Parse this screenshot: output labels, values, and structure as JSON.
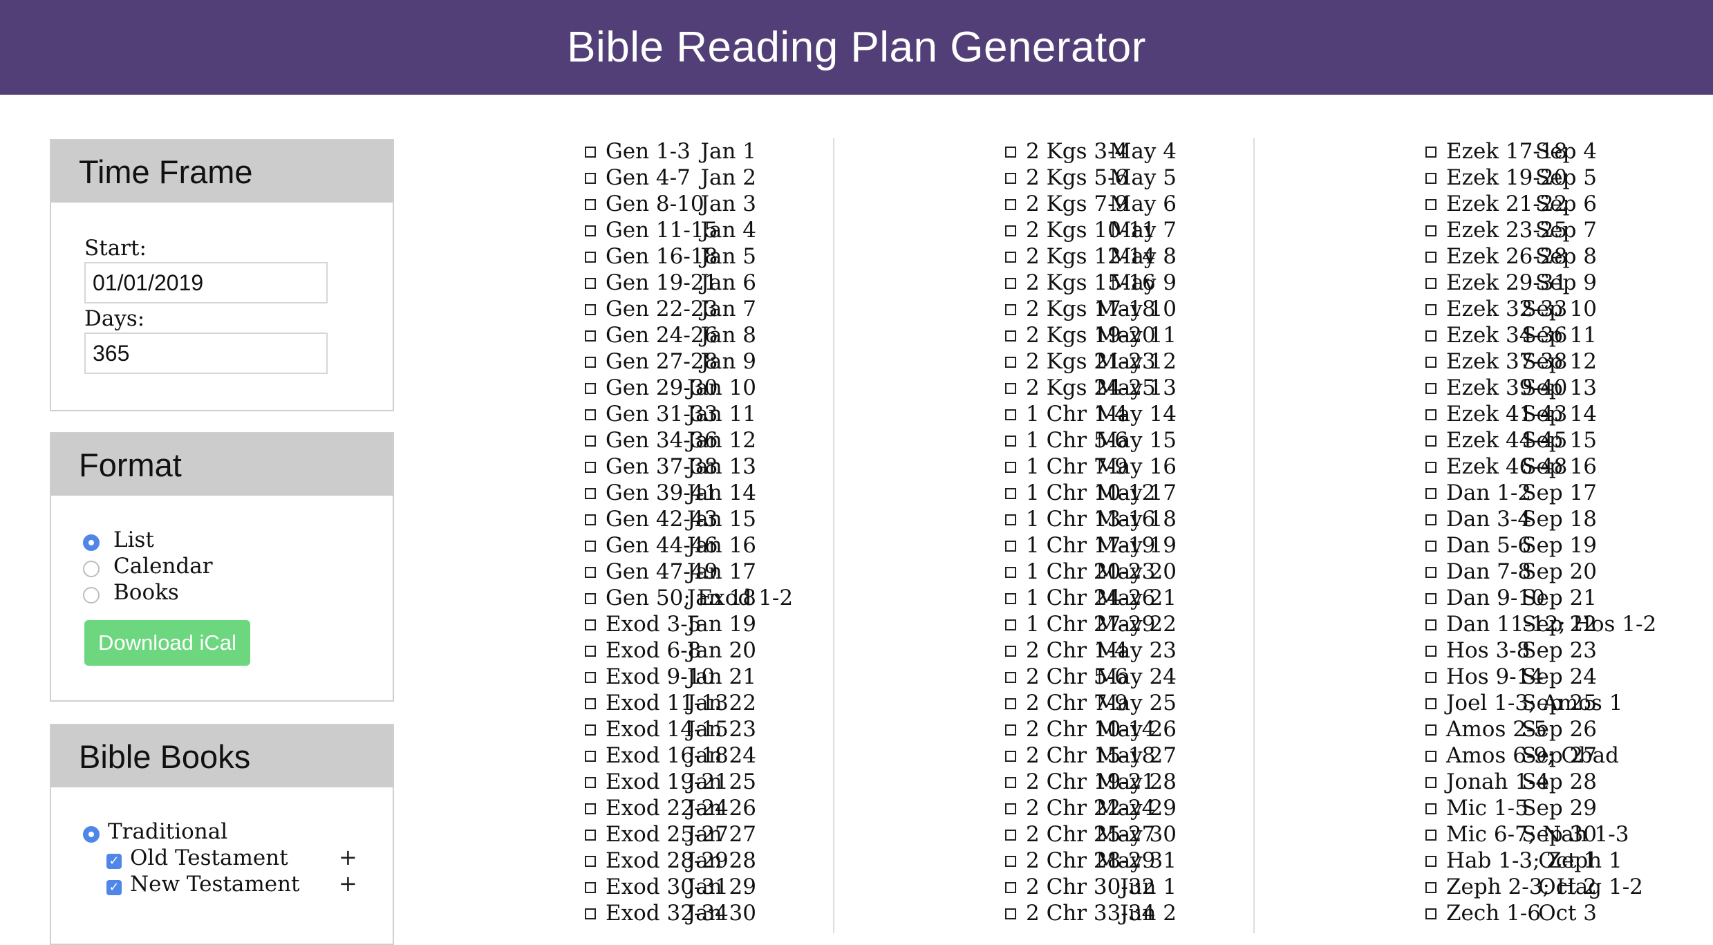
{
  "header": {
    "title": "Bible Reading Plan Generator"
  },
  "sidebar": {
    "time_frame": {
      "title": "Time Frame",
      "start_label": "Start:",
      "start_value": "01/01/2019",
      "days_label": "Days:",
      "days_value": "365"
    },
    "format": {
      "title": "Format",
      "options": [
        {
          "label": "List",
          "selected": true
        },
        {
          "label": "Calendar",
          "selected": false
        },
        {
          "label": "Books",
          "selected": false
        }
      ],
      "download_label": "Download iCal"
    },
    "bible_books": {
      "title": "Bible Books",
      "traditional_label": "Traditional",
      "old_testament_label": "Old Testament",
      "new_testament_label": "New Testament",
      "expand_symbol": "+"
    }
  },
  "checkbox_glyph": "☐",
  "schedule": {
    "columns": [
      [
        {
          "date": "Jan 1",
          "reading": "Gen 1-3"
        },
        {
          "date": "Jan 2",
          "reading": "Gen 4-7"
        },
        {
          "date": "Jan 3",
          "reading": "Gen 8-10"
        },
        {
          "date": "Jan 4",
          "reading": "Gen 11-15"
        },
        {
          "date": "Jan 5",
          "reading": "Gen 16-18"
        },
        {
          "date": "Jan 6",
          "reading": "Gen 19-21"
        },
        {
          "date": "Jan 7",
          "reading": "Gen 22-23"
        },
        {
          "date": "Jan 8",
          "reading": "Gen 24-26"
        },
        {
          "date": "Jan 9",
          "reading": "Gen 27-28"
        },
        {
          "date": "Jan 10",
          "reading": "Gen 29-30"
        },
        {
          "date": "Jan 11",
          "reading": "Gen 31-33"
        },
        {
          "date": "Jan 12",
          "reading": "Gen 34-36"
        },
        {
          "date": "Jan 13",
          "reading": "Gen 37-38"
        },
        {
          "date": "Jan 14",
          "reading": "Gen 39-41"
        },
        {
          "date": "Jan 15",
          "reading": "Gen 42-43"
        },
        {
          "date": "Jan 16",
          "reading": "Gen 44-46"
        },
        {
          "date": "Jan 17",
          "reading": "Gen 47-49"
        },
        {
          "date": "Jan 18",
          "reading": "Gen 50; Exod 1-2"
        },
        {
          "date": "Jan 19",
          "reading": "Exod 3-5"
        },
        {
          "date": "Jan 20",
          "reading": "Exod 6-8"
        },
        {
          "date": "Jan 21",
          "reading": "Exod 9-10"
        },
        {
          "date": "Jan 22",
          "reading": "Exod 11-13"
        },
        {
          "date": "Jan 23",
          "reading": "Exod 14-15"
        },
        {
          "date": "Jan 24",
          "reading": "Exod 16-18"
        },
        {
          "date": "Jan 25",
          "reading": "Exod 19-21"
        },
        {
          "date": "Jan 26",
          "reading": "Exod 22-24"
        },
        {
          "date": "Jan 27",
          "reading": "Exod 25-27"
        },
        {
          "date": "Jan 28",
          "reading": "Exod 28-29"
        },
        {
          "date": "Jan 29",
          "reading": "Exod 30-31"
        },
        {
          "date": "Jan 30",
          "reading": "Exod 32-34"
        }
      ],
      [
        {
          "date": "May 4",
          "reading": "2 Kgs 3-4"
        },
        {
          "date": "May 5",
          "reading": "2 Kgs 5-6"
        },
        {
          "date": "May 6",
          "reading": "2 Kgs 7-9"
        },
        {
          "date": "May 7",
          "reading": "2 Kgs 10-11"
        },
        {
          "date": "May 8",
          "reading": "2 Kgs 12-14"
        },
        {
          "date": "May 9",
          "reading": "2 Kgs 15-16"
        },
        {
          "date": "May 10",
          "reading": "2 Kgs 17-18"
        },
        {
          "date": "May 11",
          "reading": "2 Kgs 19-20"
        },
        {
          "date": "May 12",
          "reading": "2 Kgs 21-23"
        },
        {
          "date": "May 13",
          "reading": "2 Kgs 24-25"
        },
        {
          "date": "May 14",
          "reading": "1 Chr 1-4"
        },
        {
          "date": "May 15",
          "reading": "1 Chr 5-6"
        },
        {
          "date": "May 16",
          "reading": "1 Chr 7-9"
        },
        {
          "date": "May 17",
          "reading": "1 Chr 10-12"
        },
        {
          "date": "May 18",
          "reading": "1 Chr 13-16"
        },
        {
          "date": "May 19",
          "reading": "1 Chr 17-19"
        },
        {
          "date": "May 20",
          "reading": "1 Chr 20-23"
        },
        {
          "date": "May 21",
          "reading": "1 Chr 24-26"
        },
        {
          "date": "May 22",
          "reading": "1 Chr 27-29"
        },
        {
          "date": "May 23",
          "reading": "2 Chr 1-4"
        },
        {
          "date": "May 24",
          "reading": "2 Chr 5-6"
        },
        {
          "date": "May 25",
          "reading": "2 Chr 7-9"
        },
        {
          "date": "May 26",
          "reading": "2 Chr 10-14"
        },
        {
          "date": "May 27",
          "reading": "2 Chr 15-18"
        },
        {
          "date": "May 28",
          "reading": "2 Chr 19-21"
        },
        {
          "date": "May 29",
          "reading": "2 Chr 22-24"
        },
        {
          "date": "May 30",
          "reading": "2 Chr 25-27"
        },
        {
          "date": "May 31",
          "reading": "2 Chr 28-29"
        },
        {
          "date": "Jun 1",
          "reading": "2 Chr 30-32"
        },
        {
          "date": "Jun 2",
          "reading": "2 Chr 33-34"
        }
      ],
      [
        {
          "date": "Sep 4",
          "reading": "Ezek 17-18"
        },
        {
          "date": "Sep 5",
          "reading": "Ezek 19-20"
        },
        {
          "date": "Sep 6",
          "reading": "Ezek 21-22"
        },
        {
          "date": "Sep 7",
          "reading": "Ezek 23-25"
        },
        {
          "date": "Sep 8",
          "reading": "Ezek 26-28"
        },
        {
          "date": "Sep 9",
          "reading": "Ezek 29-31"
        },
        {
          "date": "Sep 10",
          "reading": "Ezek 32-33"
        },
        {
          "date": "Sep 11",
          "reading": "Ezek 34-36"
        },
        {
          "date": "Sep 12",
          "reading": "Ezek 37-38"
        },
        {
          "date": "Sep 13",
          "reading": "Ezek 39-40"
        },
        {
          "date": "Sep 14",
          "reading": "Ezek 41-43"
        },
        {
          "date": "Sep 15",
          "reading": "Ezek 44-45"
        },
        {
          "date": "Sep 16",
          "reading": "Ezek 46-48"
        },
        {
          "date": "Sep 17",
          "reading": "Dan 1-2"
        },
        {
          "date": "Sep 18",
          "reading": "Dan 3-4"
        },
        {
          "date": "Sep 19",
          "reading": "Dan 5-6"
        },
        {
          "date": "Sep 20",
          "reading": "Dan 7-8"
        },
        {
          "date": "Sep 21",
          "reading": "Dan 9-10"
        },
        {
          "date": "Sep 22",
          "reading": "Dan 11-12; Hos 1-2"
        },
        {
          "date": "Sep 23",
          "reading": "Hos 3-8"
        },
        {
          "date": "Sep 24",
          "reading": "Hos 9-14"
        },
        {
          "date": "Sep 25",
          "reading": "Joel 1-3; Amos 1"
        },
        {
          "date": "Sep 26",
          "reading": "Amos 2-5"
        },
        {
          "date": "Sep 27",
          "reading": "Amos 6-9; Obad"
        },
        {
          "date": "Sep 28",
          "reading": "Jonah 1-4"
        },
        {
          "date": "Sep 29",
          "reading": "Mic 1-5"
        },
        {
          "date": "Sep 30",
          "reading": "Mic 6-7; Nah 1-3"
        },
        {
          "date": "Oct 1",
          "reading": "Hab 1-3; Zeph 1"
        },
        {
          "date": "Oct 2",
          "reading": "Zeph 2-3; Hag 1-2"
        },
        {
          "date": "Oct 3",
          "reading": "Zech 1-6"
        }
      ]
    ]
  }
}
